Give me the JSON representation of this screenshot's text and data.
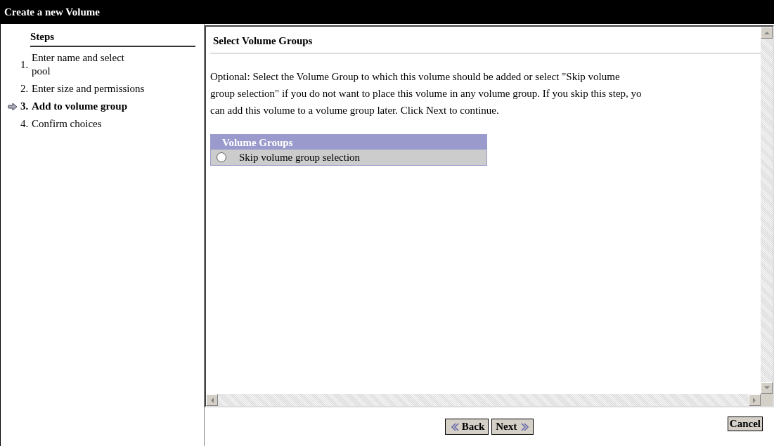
{
  "window": {
    "title": "Create a new Volume"
  },
  "steps": {
    "heading": "Steps",
    "items": [
      {
        "number": "1.",
        "label": "Enter name and select pool",
        "selected": false
      },
      {
        "number": "2.",
        "label": "Enter size and permissions",
        "selected": false
      },
      {
        "number": "3.",
        "label": "Add to volume group",
        "selected": true
      },
      {
        "number": "4.",
        "label": "Confirm choices",
        "selected": false
      }
    ]
  },
  "content": {
    "heading": "Select Volume Groups",
    "paragraph_lines": [
      "Optional: Select the Volume Group to which this volume should be added or select \"Skip volume",
      "group selection\" if you do not want to place this volume in any volume group. If you skip this step, yo",
      "can add this volume to a volume group later. Click Next to continue."
    ],
    "table": {
      "header": "Volume Groups",
      "rows": [
        {
          "label": "Skip volume group selection",
          "selected": false
        }
      ]
    }
  },
  "buttons": {
    "back": "Back",
    "next": "Next",
    "cancel": "Cancel"
  }
}
